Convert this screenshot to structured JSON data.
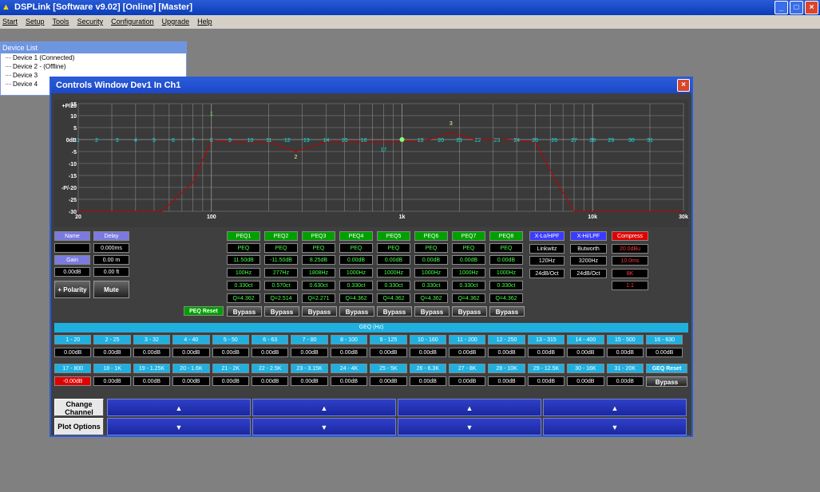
{
  "app": {
    "title": "DSPLink [Software v9.02] [Online] [Master]"
  },
  "menu": [
    "Start",
    "Setup",
    "Tools",
    "Security",
    "Configuration",
    "Upgrade",
    "Help"
  ],
  "devices": {
    "title": "Device List",
    "items": [
      "Device 1 (Connected)",
      "Device 2 - (Offline)",
      "Device 3",
      "Device 4"
    ]
  },
  "controls": {
    "title": "Controls Window Dev1 In Ch1",
    "graph": {
      "y_labels": [
        "+P/20",
        "15",
        "10",
        "5",
        "0dB",
        "-5",
        "-10",
        "-15",
        "-P/-20",
        "-25",
        "-30"
      ],
      "x_labels": [
        "20",
        "100",
        "1k",
        "10k",
        "30k"
      ],
      "point_labels": [
        "1",
        "2",
        "3",
        "4",
        "5",
        "6",
        "7",
        "8",
        "9",
        "10",
        "11",
        "12",
        "13",
        "14",
        "15",
        "16",
        "17",
        "18",
        "19",
        "20",
        "21",
        "22",
        "23",
        "24",
        "25",
        "26",
        "27",
        "28",
        "29",
        "30",
        "31"
      ],
      "markers": {
        "m1": "1",
        "m2": "2",
        "m3": "3",
        "m17": "17"
      }
    },
    "left": {
      "name": "Name",
      "delay": "Delay",
      "delay_val": "0.000ms",
      "gain": "Gain",
      "dist": "0.00 m",
      "gain_val": "0.00dB",
      "ft": "0.00 ft",
      "polarity": "+ Polarity",
      "mute": "Mute"
    },
    "peq": {
      "headers": [
        "PEQ1",
        "PEQ2",
        "PEQ3",
        "PEQ4",
        "PEQ5",
        "PEQ6",
        "PEQ7",
        "PEQ8"
      ],
      "type": [
        "PEQ",
        "PEQ",
        "PEQ",
        "PEQ",
        "PEQ",
        "PEQ",
        "PEQ",
        "PEQ"
      ],
      "gain": [
        "11.50dB",
        "-11.50dB",
        "8.25dB",
        "0.00dB",
        "0.00dB",
        "0.00dB",
        "0.00dB",
        "0.00dB"
      ],
      "freq": [
        "100Hz",
        "277Hz",
        "1808Hz",
        "1000Hz",
        "1000Hz",
        "1000Hz",
        "1000Hz",
        "1000Hz"
      ],
      "bw": [
        "0.330ct",
        "0.570ct",
        "0.630ct",
        "0.330ct",
        "0.330ct",
        "0.330ct",
        "0.330ct",
        "0.330ct"
      ],
      "q": [
        "Q=4.362",
        "Q=2.514",
        "Q=2.271",
        "Q=4.362",
        "Q=4.362",
        "Q=4.362",
        "Q=4.362",
        "Q=4.362"
      ],
      "reset": "PEQ Reset",
      "bypass": "Bypass"
    },
    "xover": {
      "lo": [
        "X-Lo/HPF",
        "Linkwitz",
        "120Hz",
        "24dB/Oct"
      ],
      "hi": [
        "X-Hi/LPF",
        "Butworth",
        "3200Hz",
        "24dB/Oct"
      ],
      "comp": [
        "Compress",
        "20.0dBu",
        "10.0ms",
        "8K",
        "1:1"
      ]
    },
    "geq": {
      "title": "GEQ (Hz)",
      "row1": [
        "1 - 20",
        "2 - 25",
        "3 - 32",
        "4 - 40",
        "5 - 50",
        "6 - 63",
        "7 - 80",
        "8 - 100",
        "9 - 125",
        "10 - 160",
        "11 - 200",
        "12 - 250",
        "13 - 315",
        "14 - 400",
        "15 - 500",
        "16 - 630"
      ],
      "row2": [
        "17 - 800",
        "18 - 1K",
        "19 - 1.25K",
        "20 - 1.6K",
        "21 - 2K",
        "22 - 2.5K",
        "23 - 3.15K",
        "24 - 4K",
        "25 - 5K",
        "26 - 6.3K",
        "27 - 8K",
        "28 - 10K",
        "29 - 12.5K",
        "30 - 16K",
        "31 - 20K"
      ],
      "val1": [
        "0.00dB",
        "0.00dB",
        "0.00dB",
        "0.00dB",
        "0.00dB",
        "0.00dB",
        "0.00dB",
        "0.00dB",
        "0.00dB",
        "0.00dB",
        "0.00dB",
        "0.00dB",
        "0.00dB",
        "0.00dB",
        "0.00dB",
        "0.00dB"
      ],
      "val2": [
        "-0.00dB",
        "0.00dB",
        "0.00dB",
        "0.00dB",
        "0.00dB",
        "0.00dB",
        "0.00dB",
        "0.00dB",
        "0.00dB",
        "0.00dB",
        "0.00dB",
        "0.00dB",
        "0.00dB",
        "0.00dB",
        "0.00dB"
      ],
      "reset": "GEQ Reset",
      "bypass": "Bypass"
    },
    "bottom": {
      "change": "Change Channel",
      "plot": "Plot Options",
      "up": "▲",
      "down": "▼"
    }
  }
}
